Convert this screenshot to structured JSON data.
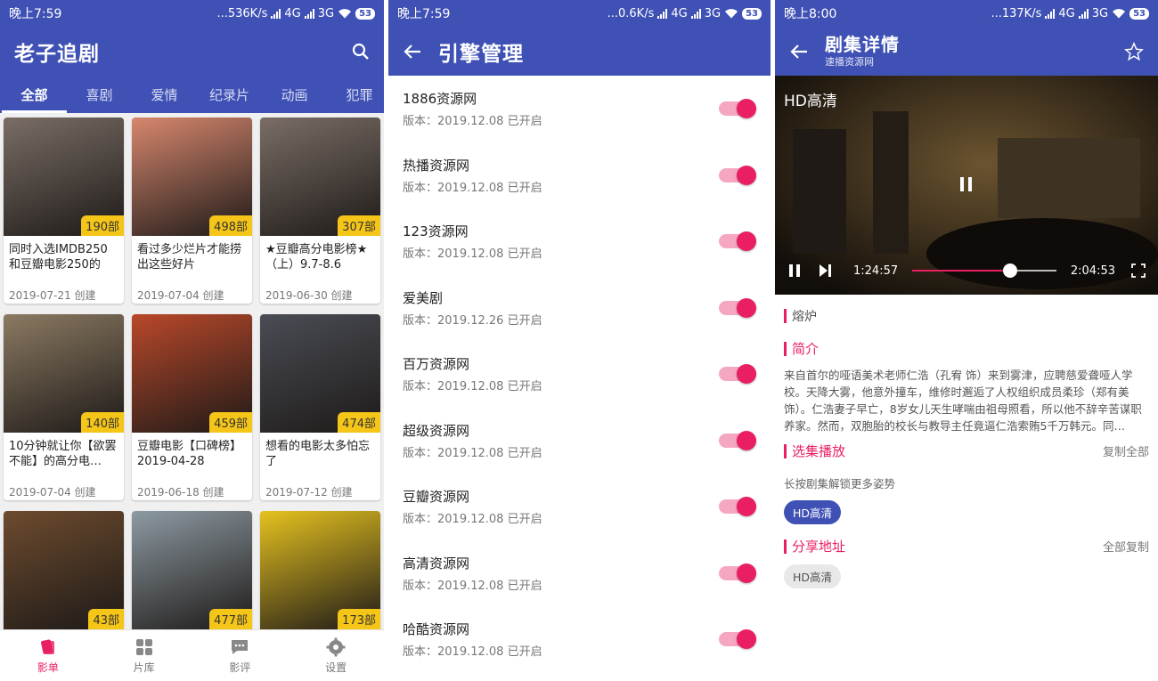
{
  "status_bars": [
    {
      "time": "晚上7:59",
      "speed": "...536K/s",
      "net1": "4G",
      "net2": "3G",
      "battery": "53"
    },
    {
      "time": "晚上7:59",
      "speed": "...0.6K/s",
      "net1": "4G",
      "net2": "3G",
      "battery": "53"
    },
    {
      "time": "晚上8:00",
      "speed": "...137K/s",
      "net1": "4G",
      "net2": "3G",
      "battery": "53"
    }
  ],
  "screen1": {
    "app_title": "老子追剧",
    "tabs": [
      "全部",
      "喜剧",
      "爱情",
      "纪录片",
      "动画",
      "犯罪"
    ],
    "cards": [
      {
        "title": "同时入选IMDB250和豆瓣电影250的",
        "date": "2019-07-21 创建",
        "count": "190部",
        "tone": "#7a6e66"
      },
      {
        "title": "看过多少烂片才能捞出这些好片",
        "date": "2019-07-04 创建",
        "count": "498部",
        "tone": "#d7876e"
      },
      {
        "title": "★豆瓣高分电影榜★（上）9.7-8.6",
        "date": "2019-06-30 创建",
        "count": "307部",
        "tone": "#7a6e66"
      },
      {
        "title": "10分钟就让你【欲罢不能】的高分电…",
        "date": "2019-07-04 创建",
        "count": "140部",
        "tone": "#8b7a62"
      },
      {
        "title": "豆瓣电影【口碑榜】2019-04-28",
        "date": "2019-06-18 创建",
        "count": "459部",
        "tone": "#b9482a"
      },
      {
        "title": "想看的电影太多怕忘了",
        "date": "2019-07-12 创建",
        "count": "474部",
        "tone": "#4a4d55"
      },
      {
        "title": "",
        "date": "",
        "count": "43部",
        "tone": "#6d4b2e"
      },
      {
        "title": "",
        "date": "",
        "count": "477部",
        "tone": "#8d9aa2"
      },
      {
        "title": "",
        "date": "",
        "count": "173部",
        "tone": "#e6c21f"
      }
    ],
    "bottom_nav": [
      {
        "label": "影单",
        "icon": "cards-icon"
      },
      {
        "label": "片库",
        "icon": "grid-icon"
      },
      {
        "label": "影评",
        "icon": "comment-icon"
      },
      {
        "label": "设置",
        "icon": "gear-icon"
      }
    ]
  },
  "screen2": {
    "title": "引擎管理",
    "engines": [
      {
        "name": "1886资源网",
        "meta": "版本：2019.12.08  已开启"
      },
      {
        "name": "热播资源网",
        "meta": "版本：2019.12.08  已开启"
      },
      {
        "name": "123资源网",
        "meta": "版本：2019.12.08  已开启"
      },
      {
        "name": "爱美剧",
        "meta": "版本：2019.12.26  已开启"
      },
      {
        "name": "百万资源网",
        "meta": "版本：2019.12.08  已开启"
      },
      {
        "name": "超级资源网",
        "meta": "版本：2019.12.08  已开启"
      },
      {
        "name": "豆瓣资源网",
        "meta": "版本：2019.12.08  已开启"
      },
      {
        "name": "高清资源网",
        "meta": "版本：2019.12.08  已开启"
      },
      {
        "name": "哈酷资源网",
        "meta": "版本：2019.12.08  已开启"
      }
    ]
  },
  "screen3": {
    "title": "剧集详情",
    "subtitle": "速播资源网",
    "player": {
      "quality_label": "HD高清",
      "current_time": "1:24:57",
      "total_time": "2:04:53",
      "progress": 0.68
    },
    "movie_name": "熔炉",
    "intro_title": "简介",
    "intro_text": "来自首尔的哑语美术老师仁浩（孔宥 饰）来到雾津，应聘慈爱聋哑人学校。天降大雾，他意外撞车，维修时邂逅了人权组织成员柔珍（郑有美 饰）。仁浩妻子早亡，8岁女儿天生哮喘由祖母照看，所以他不辞辛苦谋职养家。然而，双胞胎的校长与教导主任竟逼仁浩索贿5千万韩元。同…",
    "episodes_title": "选集播放",
    "episodes_action": "复制全部",
    "episodes_hint": "长按剧集解锁更多姿势",
    "episode_chip": "HD高清",
    "share_title": "分享地址",
    "share_action": "全部复制",
    "share_chip": "HD高清"
  }
}
